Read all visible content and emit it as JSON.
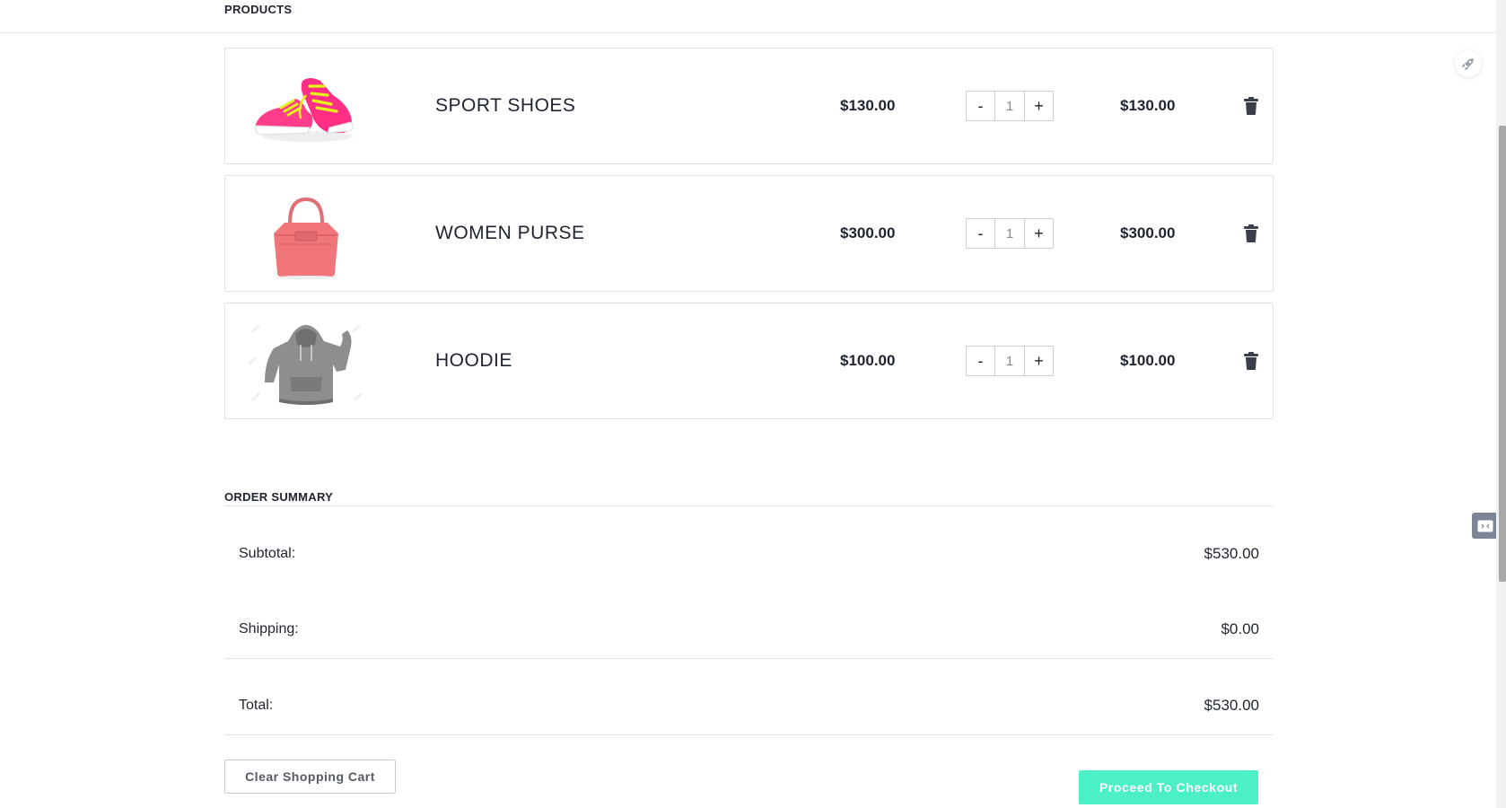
{
  "products_heading": "PRODUCTS",
  "cart": {
    "items": [
      {
        "name": "SPORT SHOES",
        "unit_price": "$130.00",
        "quantity": "1",
        "line_total": "$130.00",
        "image_icon": "pink-sneakers-image"
      },
      {
        "name": "WOMEN PURSE",
        "unit_price": "$300.00",
        "quantity": "1",
        "line_total": "$300.00",
        "image_icon": "pink-handbag-image"
      },
      {
        "name": "HOODIE",
        "unit_price": "$100.00",
        "quantity": "1",
        "line_total": "$100.00",
        "image_icon": "gray-hoodie-image"
      }
    ],
    "minus_label": "-",
    "plus_label": "+"
  },
  "summary": {
    "heading": "ORDER SUMMARY",
    "subtotal_label": "Subtotal:",
    "subtotal_value": "$530.00",
    "shipping_label": "Shipping:",
    "shipping_value": "$0.00",
    "total_label": "Total:",
    "total_value": "$530.00"
  },
  "actions": {
    "clear_label": "Clear Shopping Cart",
    "checkout_label": "Proceed To Checkout"
  },
  "colors": {
    "checkout_accent": "#4bf0c6",
    "text": "#1f2430",
    "border": "#e2e2e2"
  }
}
